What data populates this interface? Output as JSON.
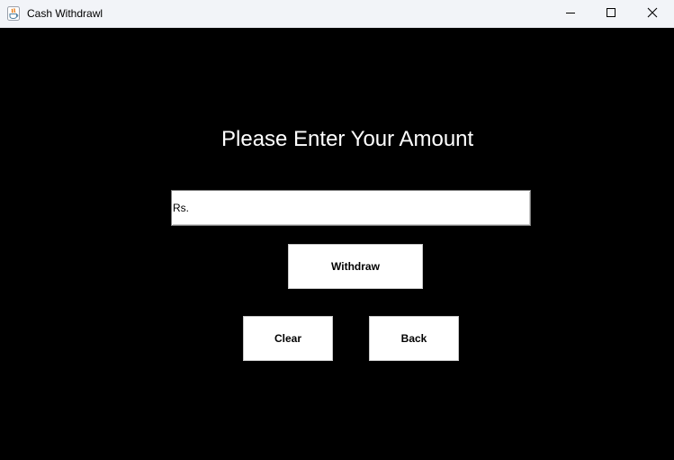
{
  "window": {
    "title": "Cash Withdrawl",
    "icons": {
      "app": "java-cup-icon",
      "minimize": "minimize-icon",
      "maximize": "maximize-icon",
      "close": "close-icon"
    }
  },
  "form": {
    "heading": "Please Enter Your Amount",
    "amount_value": "Rs.",
    "withdraw_label": "Withdraw",
    "clear_label": "Clear",
    "back_label": "Back"
  },
  "colors": {
    "background": "#000000",
    "titlebar": "#f2f4f8",
    "heading_text": "#ffffff",
    "button_bg": "#ffffff"
  }
}
